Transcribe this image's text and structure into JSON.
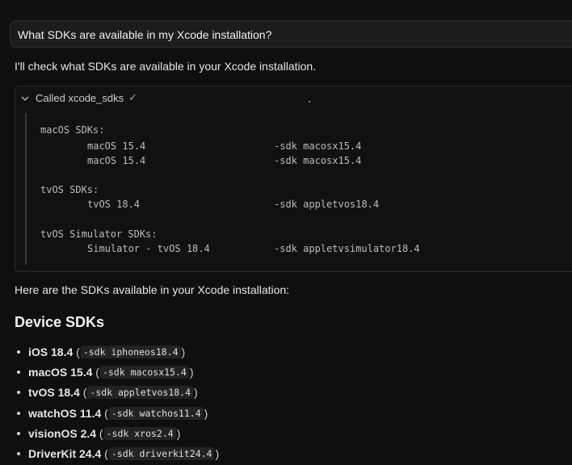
{
  "user_message": "What SDKs are available in my Xcode installation?",
  "intro_text": "I'll check what SDKs are available in your Xcode installation.",
  "tool_call": {
    "label": "Called xcode_sdks",
    "output": [
      {
        "group": "macOS SDKs:",
        "rows": [
          {
            "name": "macOS 15.4",
            "flag": "-sdk macosx15.4"
          },
          {
            "name": "macOS 15.4",
            "flag": "-sdk macosx15.4"
          }
        ]
      },
      {
        "group": "tvOS SDKs:",
        "rows": [
          {
            "name": "tvOS 18.4",
            "flag": "-sdk appletvos18.4"
          }
        ]
      },
      {
        "group": "tvOS Simulator SDKs:",
        "rows": [
          {
            "name": "Simulator - tvOS 18.4",
            "flag": "-sdk appletvsimulator18.4"
          }
        ]
      }
    ]
  },
  "summary_text": "Here are the SDKs available in your Xcode installation:",
  "device_heading": "Device SDKs",
  "device_sdks": [
    {
      "name": "iOS 18.4",
      "flag": "-sdk iphoneos18.4"
    },
    {
      "name": "macOS 15.4",
      "flag": "-sdk macosx15.4"
    },
    {
      "name": "tvOS 18.4",
      "flag": "-sdk appletvos18.4"
    },
    {
      "name": "watchOS 11.4",
      "flag": "-sdk watchos11.4"
    },
    {
      "name": "visionOS 2.4",
      "flag": "-sdk xros2.4"
    },
    {
      "name": "DriverKit 24.4",
      "flag": "-sdk driverkit24.4"
    }
  ],
  "colors": {
    "background": "#0f0f10",
    "check": "#6fbf73"
  },
  "icons": [
    "chevron-down-icon",
    "checkmark-icon"
  ]
}
